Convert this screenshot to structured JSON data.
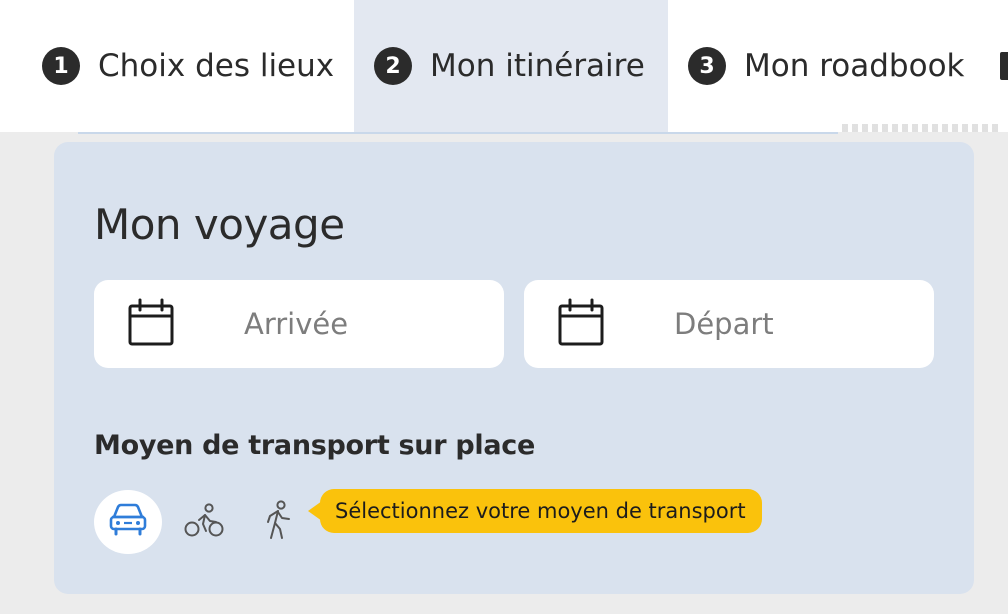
{
  "tabs": [
    {
      "number": "1",
      "label": "Choix des lieux",
      "active": false
    },
    {
      "number": "2",
      "label": "Mon itinéraire",
      "active": true
    },
    {
      "number": "3",
      "label": "Mon roadbook",
      "active": false
    }
  ],
  "trip": {
    "title": "Mon voyage",
    "arrival": {
      "placeholder": "Arrivée",
      "icon": "calendar-icon"
    },
    "departure": {
      "placeholder": "Départ",
      "icon": "calendar-icon"
    }
  },
  "transport": {
    "heading": "Moyen de transport sur place",
    "modes": [
      {
        "icon": "car-icon",
        "selected": true
      },
      {
        "icon": "bicycle-icon",
        "selected": false
      },
      {
        "icon": "walking-icon",
        "selected": false
      }
    ],
    "tooltip": "Sélectionnez votre moyen de transport"
  },
  "colors": {
    "accent": "#2f7dd9",
    "tooltip": "#fac20c",
    "card": "#d9e2ee",
    "active_tab": "#e3e8f1"
  }
}
